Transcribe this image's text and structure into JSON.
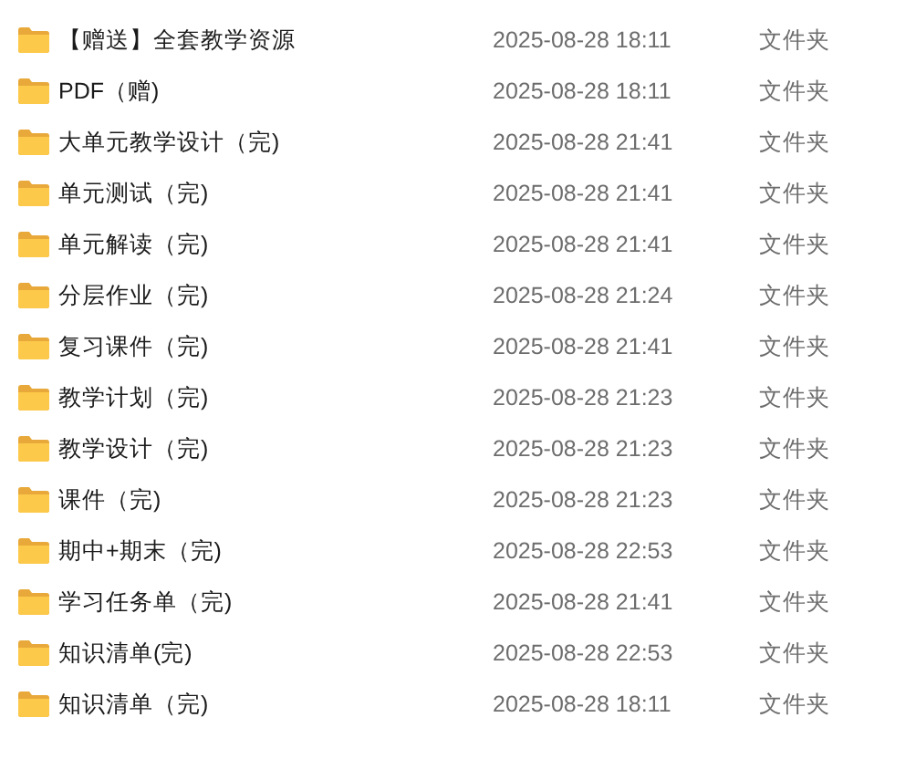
{
  "files": [
    {
      "name": "【赠送】全套教学资源",
      "modified": "2025-08-28 18:11",
      "type": "文件夹"
    },
    {
      "name": "PDF（赠)",
      "modified": "2025-08-28 18:11",
      "type": "文件夹"
    },
    {
      "name": "大单元教学设计（完)",
      "modified": "2025-08-28 21:41",
      "type": "文件夹"
    },
    {
      "name": "单元测试（完)",
      "modified": "2025-08-28 21:41",
      "type": "文件夹"
    },
    {
      "name": "单元解读（完)",
      "modified": "2025-08-28 21:41",
      "type": "文件夹"
    },
    {
      "name": "分层作业（完)",
      "modified": "2025-08-28 21:24",
      "type": "文件夹"
    },
    {
      "name": "复习课件（完)",
      "modified": "2025-08-28 21:41",
      "type": "文件夹"
    },
    {
      "name": "教学计划（完)",
      "modified": "2025-08-28 21:23",
      "type": "文件夹"
    },
    {
      "name": "教学设计（完)",
      "modified": "2025-08-28 21:23",
      "type": "文件夹"
    },
    {
      "name": "课件（完)",
      "modified": "2025-08-28 21:23",
      "type": "文件夹"
    },
    {
      "name": "期中+期末（完)",
      "modified": "2025-08-28 22:53",
      "type": "文件夹"
    },
    {
      "name": "学习任务单（完)",
      "modified": "2025-08-28 21:41",
      "type": "文件夹"
    },
    {
      "name": "知识清单(完)",
      "modified": "2025-08-28 22:53",
      "type": "文件夹"
    },
    {
      "name": "知识清单（完)",
      "modified": "2025-08-28 18:11",
      "type": "文件夹"
    }
  ]
}
